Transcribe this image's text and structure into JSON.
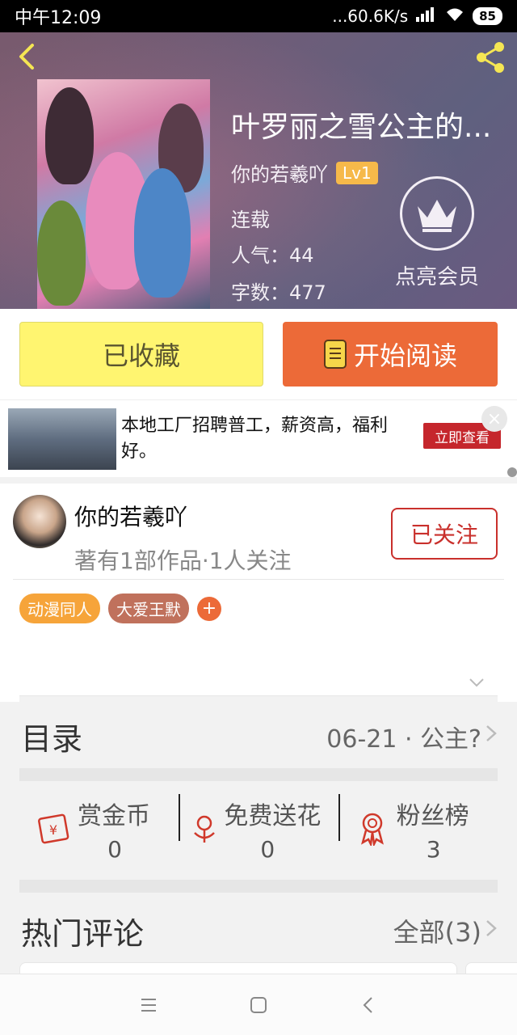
{
  "status_bar": {
    "time": "中午12:09",
    "network_speed": "...60.6K/s",
    "battery": "85"
  },
  "book": {
    "title": "叶罗丽之雪公主的...",
    "author": "你的若羲吖",
    "level": "Lv1",
    "status": "连载",
    "popularity": "人气：44",
    "word_count": "字数：477"
  },
  "vip": {
    "label": "点亮会员"
  },
  "actions": {
    "collect_label": "已收藏",
    "read_label": "开始阅读"
  },
  "ad": {
    "text": "本地工厂招聘普工，薪资高，福利好。",
    "button_label": "立即查看",
    "close": "×"
  },
  "author_card": {
    "name": "你的若羲吖",
    "subtitle": "著有1部作品·1人关注",
    "follow_label": "已关注",
    "tags": [
      {
        "label": "动漫同人",
        "color": "#f6a43a"
      },
      {
        "label": "大爱王默",
        "color": "#c0715c"
      }
    ],
    "tag_add": "+"
  },
  "catalog": {
    "title": "目录",
    "latest": "06-21 · 公主?"
  },
  "stats": [
    {
      "label": "赏金币",
      "value": "0",
      "icon": "coin-envelope-icon"
    },
    {
      "label": "免费送花",
      "value": "0",
      "icon": "flower-icon"
    },
    {
      "label": "粉丝榜",
      "value": "3",
      "icon": "medal-icon"
    }
  ],
  "comments": {
    "title": "热门评论",
    "all_label": "全部(3)"
  },
  "colors": {
    "accent_orange": "#ec6a38",
    "collect_yellow": "#fff570",
    "follow_red": "#c9302c"
  }
}
